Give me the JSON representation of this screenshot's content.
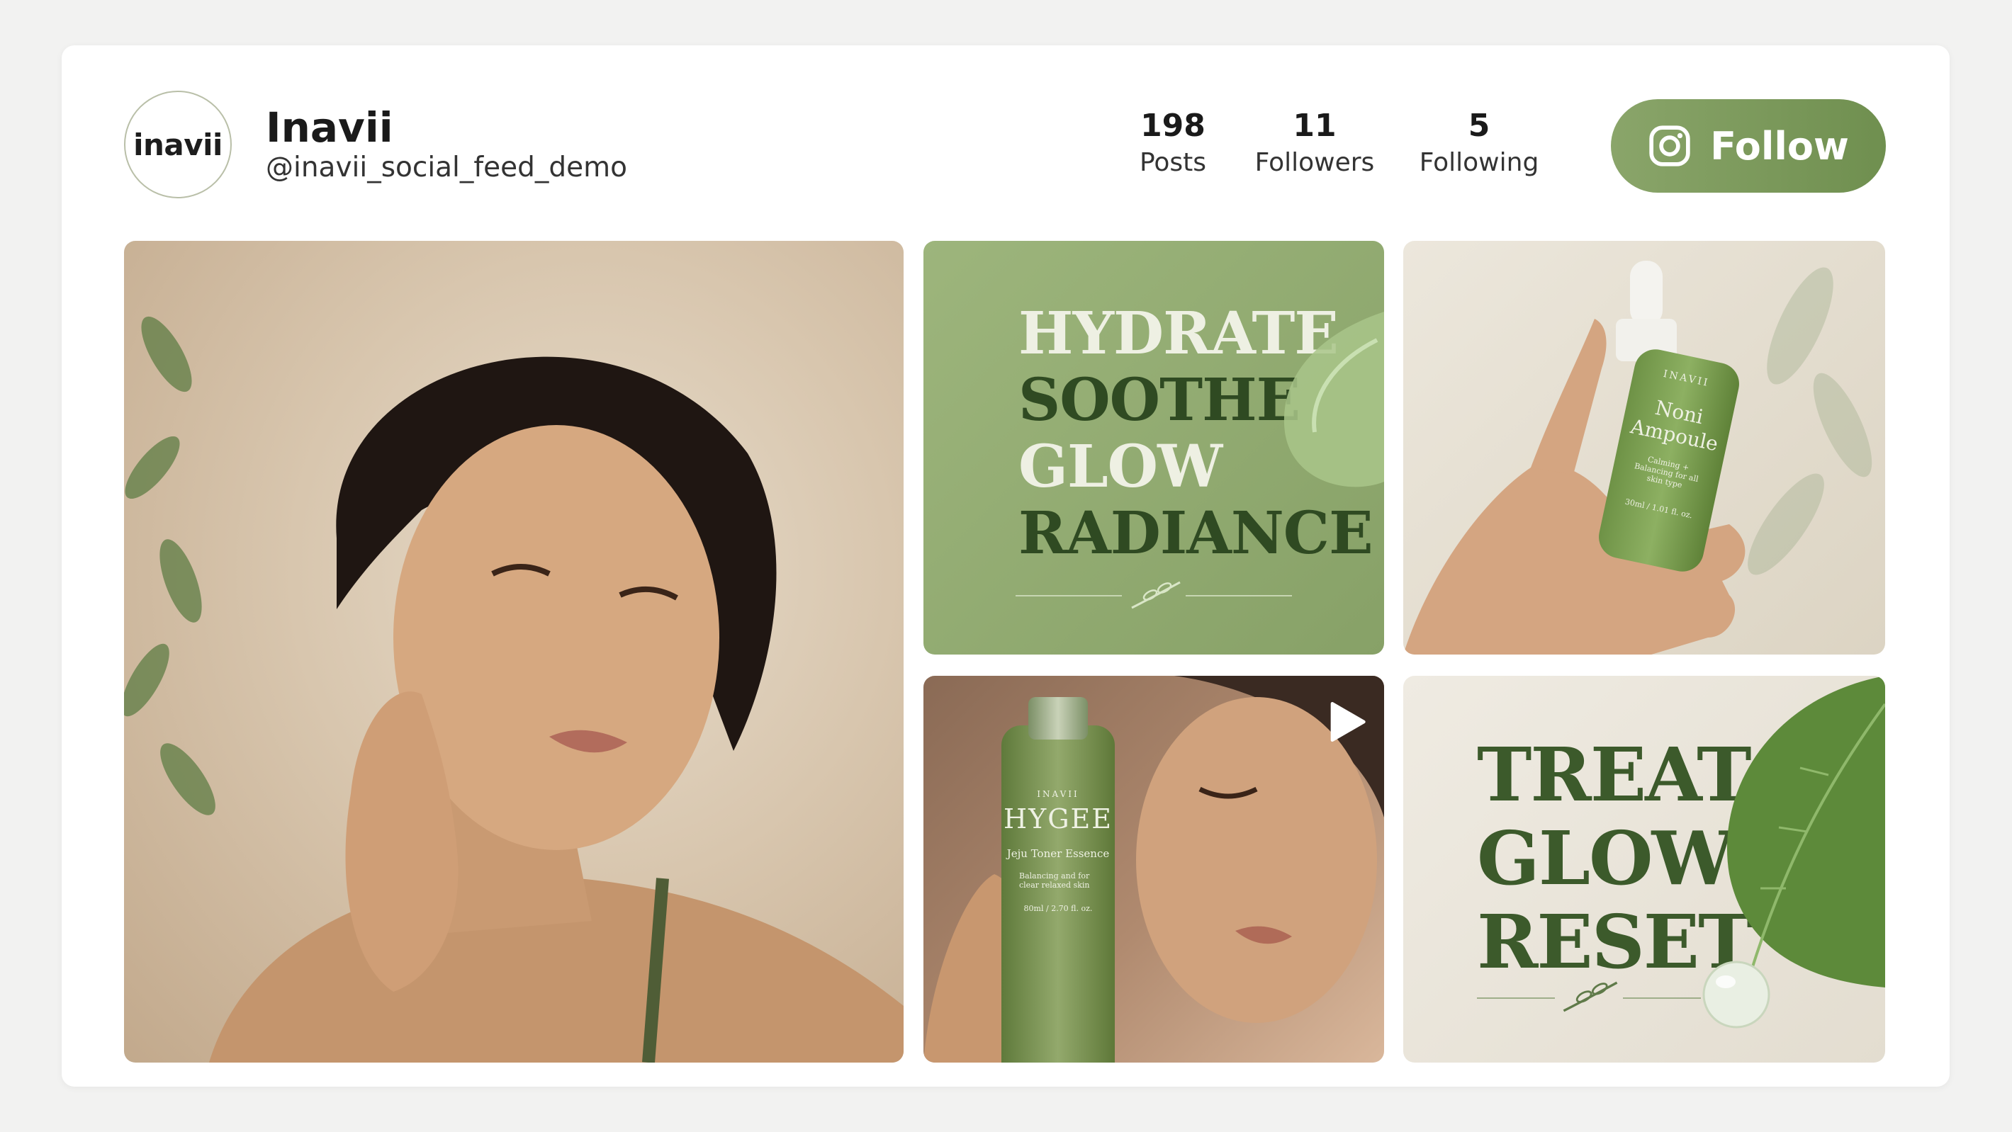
{
  "profile": {
    "avatar_text": "inavii",
    "name": "Inavii",
    "handle": "@inavii_social_feed_demo"
  },
  "stats": [
    {
      "value": "198",
      "label": "Posts"
    },
    {
      "value": "11",
      "label": "Followers"
    },
    {
      "value": "5",
      "label": "Following"
    }
  ],
  "follow_button": {
    "label": "Follow",
    "icon": "instagram-icon"
  },
  "posts": {
    "tile2_words": [
      "HYDRATE",
      "SOOTHE",
      "GLOW",
      "RADIANCE"
    ],
    "tile3_bottle": {
      "brand": "INAVII",
      "name_line1": "Noni",
      "name_line2": "Ampoule",
      "desc": "Calming + Balancing for all skin type",
      "volume": "30ml / 1.01 fl. oz."
    },
    "tile4_bottle": {
      "brand": "INAVII",
      "name": "HYGEE",
      "product": "Jeju Toner Essence",
      "desc": "Balancing and for clear relaxed skin",
      "volume": "80ml / 2.70 fl. oz."
    },
    "tile5_words": [
      "TREAT",
      "GLOW",
      "RESET"
    ]
  },
  "colors": {
    "accent": "#7a9a5a",
    "dark_green": "#2f4a22"
  }
}
